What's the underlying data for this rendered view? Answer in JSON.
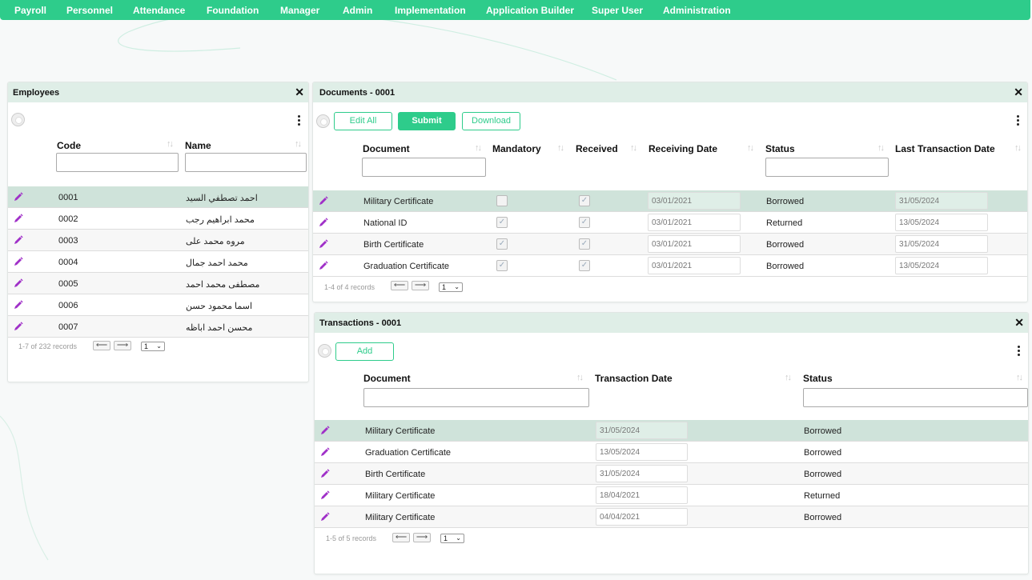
{
  "nav": {
    "items": [
      "Payroll",
      "Personnel",
      "Attendance",
      "Foundation",
      "Manager",
      "Admin",
      "Implementation",
      "Application Builder",
      "Super User",
      "Administration"
    ]
  },
  "colors": {
    "accent": "#2ecc8b",
    "selected_row": "#cfe3da",
    "panel_header": "#dfeee7",
    "edit_icon": "#a030c8"
  },
  "employees": {
    "title": "Employees",
    "columns": [
      "Code",
      "Name"
    ],
    "rows": [
      {
        "code": "0001",
        "name": "احمد تصطفي السيد"
      },
      {
        "code": "0002",
        "name": "محمد ابراهيم رجب"
      },
      {
        "code": "0003",
        "name": "مروه محمد على"
      },
      {
        "code": "0004",
        "name": "محمد احمد جمال"
      },
      {
        "code": "0005",
        "name": "مصطفى محمد احمد"
      },
      {
        "code": "0006",
        "name": "اسما محمود حسن"
      },
      {
        "code": "0007",
        "name": "محسن احمد اباظه"
      }
    ],
    "pager": {
      "text": "1-7 of 232 records",
      "page": "1"
    }
  },
  "documents": {
    "title": "Documents - 0001",
    "buttons": {
      "edit_all": "Edit All",
      "submit": "Submit",
      "download": "Download"
    },
    "columns": [
      "Document",
      "Mandatory",
      "Received",
      "Receiving Date",
      "Status",
      "Last Transaction Date"
    ],
    "rows": [
      {
        "document": "Military Certificate",
        "mandatory": false,
        "received": true,
        "receiving_date": "03/01/2021",
        "status": "Borrowed",
        "last_date": "31/05/2024"
      },
      {
        "document": "National ID",
        "mandatory": true,
        "received": true,
        "receiving_date": "03/01/2021",
        "status": "Returned",
        "last_date": "13/05/2024"
      },
      {
        "document": "Birth Certificate",
        "mandatory": true,
        "received": true,
        "receiving_date": "03/01/2021",
        "status": "Borrowed",
        "last_date": "31/05/2024"
      },
      {
        "document": "Graduation Certificate",
        "mandatory": true,
        "received": true,
        "receiving_date": "03/01/2021",
        "status": "Borrowed",
        "last_date": "13/05/2024"
      }
    ],
    "pager": {
      "text": "1-4 of 4 records",
      "page": "1"
    }
  },
  "transactions": {
    "title": "Transactions - 0001",
    "buttons": {
      "add": "Add"
    },
    "columns": [
      "Document",
      "Transaction Date",
      "Status"
    ],
    "rows": [
      {
        "document": "Military Certificate",
        "date": "31/05/2024",
        "status": "Borrowed"
      },
      {
        "document": "Graduation Certificate",
        "date": "13/05/2024",
        "status": "Borrowed"
      },
      {
        "document": "Birth Certificate",
        "date": "31/05/2024",
        "status": "Borrowed"
      },
      {
        "document": "Military Certificate",
        "date": "18/04/2021",
        "status": "Returned"
      },
      {
        "document": "Military Certificate",
        "date": "04/04/2021",
        "status": "Borrowed"
      }
    ],
    "pager": {
      "text": "1-5 of 5 records",
      "page": "1"
    }
  },
  "icons": {
    "close": "close-icon",
    "edit": "pencil-icon",
    "sort": "sort-icon",
    "menu": "kebab-menu-icon",
    "prev": "arrow-left-icon",
    "next": "arrow-right-icon",
    "toggle": "panel-toggle-icon",
    "checkbox": "checkbox-icon"
  }
}
